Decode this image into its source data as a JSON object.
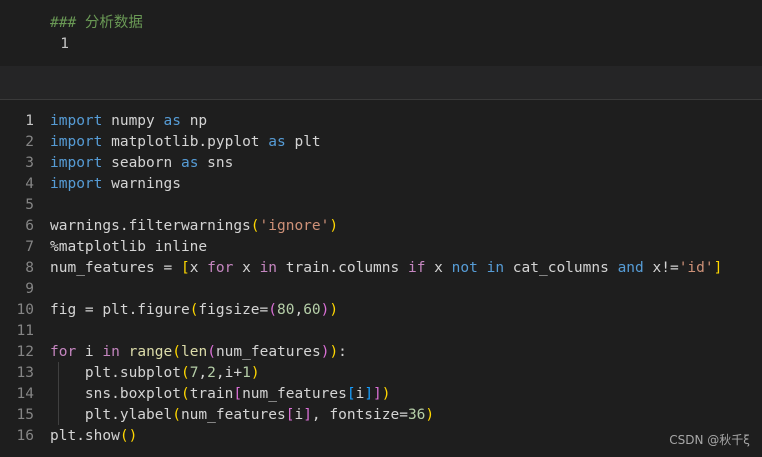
{
  "markdown_cell": {
    "line_number": "1",
    "text": "### 分析数据"
  },
  "code_cell": {
    "lines": [
      {
        "n": "1",
        "tokens": [
          {
            "t": "import",
            "c": "t-kw"
          },
          {
            "t": " numpy ",
            "c": "t-id"
          },
          {
            "t": "as",
            "c": "t-kw"
          },
          {
            "t": " np",
            "c": "t-id"
          }
        ]
      },
      {
        "n": "2",
        "tokens": [
          {
            "t": "import",
            "c": "t-kw"
          },
          {
            "t": " matplotlib.pyplot ",
            "c": "t-id"
          },
          {
            "t": "as",
            "c": "t-kw"
          },
          {
            "t": " plt",
            "c": "t-id"
          }
        ]
      },
      {
        "n": "3",
        "tokens": [
          {
            "t": "import",
            "c": "t-kw"
          },
          {
            "t": " seaborn ",
            "c": "t-id"
          },
          {
            "t": "as",
            "c": "t-kw"
          },
          {
            "t": " sns",
            "c": "t-id"
          }
        ]
      },
      {
        "n": "4",
        "tokens": [
          {
            "t": "import",
            "c": "t-kw"
          },
          {
            "t": " warnings",
            "c": "t-id"
          }
        ]
      },
      {
        "n": "5",
        "tokens": []
      },
      {
        "n": "6",
        "tokens": [
          {
            "t": "warnings.filterwarnings",
            "c": "t-id"
          },
          {
            "t": "(",
            "c": "p1"
          },
          {
            "t": "'ignore'",
            "c": "t-str"
          },
          {
            "t": ")",
            "c": "p1"
          }
        ]
      },
      {
        "n": "7",
        "tokens": [
          {
            "t": "%matplotlib inline",
            "c": "t-id"
          }
        ]
      },
      {
        "n": "8",
        "tokens": [
          {
            "t": "num_features = ",
            "c": "t-id"
          },
          {
            "t": "[",
            "c": "p1"
          },
          {
            "t": "x ",
            "c": "t-id"
          },
          {
            "t": "for",
            "c": "t-ctl"
          },
          {
            "t": " x ",
            "c": "t-id"
          },
          {
            "t": "in",
            "c": "t-ctl"
          },
          {
            "t": " train.columns ",
            "c": "t-id"
          },
          {
            "t": "if",
            "c": "t-ctl"
          },
          {
            "t": " x ",
            "c": "t-id"
          },
          {
            "t": "not",
            "c": "t-kw"
          },
          {
            "t": " ",
            "c": "t-id"
          },
          {
            "t": "in",
            "c": "t-kw"
          },
          {
            "t": " cat_columns ",
            "c": "t-id"
          },
          {
            "t": "and",
            "c": "t-kw"
          },
          {
            "t": " x!=",
            "c": "t-id"
          },
          {
            "t": "'id'",
            "c": "t-str"
          },
          {
            "t": "]",
            "c": "p1"
          }
        ]
      },
      {
        "n": "9",
        "tokens": []
      },
      {
        "n": "10",
        "tokens": [
          {
            "t": "fig = plt.figure",
            "c": "t-id"
          },
          {
            "t": "(",
            "c": "p1"
          },
          {
            "t": "figsize=",
            "c": "t-id"
          },
          {
            "t": "(",
            "c": "p2"
          },
          {
            "t": "80",
            "c": "t-num"
          },
          {
            "t": ",",
            "c": "t-id"
          },
          {
            "t": "60",
            "c": "t-num"
          },
          {
            "t": ")",
            "c": "p2"
          },
          {
            "t": ")",
            "c": "p1"
          }
        ]
      },
      {
        "n": "11",
        "tokens": []
      },
      {
        "n": "12",
        "tokens": [
          {
            "t": "for",
            "c": "t-ctl"
          },
          {
            "t": " i ",
            "c": "t-id"
          },
          {
            "t": "in",
            "c": "t-ctl"
          },
          {
            "t": " ",
            "c": "t-id"
          },
          {
            "t": "range",
            "c": "t-fn"
          },
          {
            "t": "(",
            "c": "p1"
          },
          {
            "t": "len",
            "c": "t-fn"
          },
          {
            "t": "(",
            "c": "p2"
          },
          {
            "t": "num_features",
            "c": "t-id"
          },
          {
            "t": ")",
            "c": "p2"
          },
          {
            "t": ")",
            "c": "p1"
          },
          {
            "t": ":",
            "c": "t-id"
          }
        ]
      },
      {
        "n": "13",
        "tokens": [
          {
            "t": "    plt.subplot",
            "c": "t-id"
          },
          {
            "t": "(",
            "c": "p1"
          },
          {
            "t": "7",
            "c": "t-num"
          },
          {
            "t": ",",
            "c": "t-id"
          },
          {
            "t": "2",
            "c": "t-num"
          },
          {
            "t": ",i+",
            "c": "t-id"
          },
          {
            "t": "1",
            "c": "t-num"
          },
          {
            "t": ")",
            "c": "p1"
          }
        ]
      },
      {
        "n": "14",
        "tokens": [
          {
            "t": "    sns.boxplot",
            "c": "t-id"
          },
          {
            "t": "(",
            "c": "p1"
          },
          {
            "t": "train",
            "c": "t-id"
          },
          {
            "t": "[",
            "c": "p2"
          },
          {
            "t": "num_features",
            "c": "t-id"
          },
          {
            "t": "[",
            "c": "p3"
          },
          {
            "t": "i",
            "c": "t-id"
          },
          {
            "t": "]",
            "c": "p3"
          },
          {
            "t": "]",
            "c": "p2"
          },
          {
            "t": ")",
            "c": "p1"
          }
        ]
      },
      {
        "n": "15",
        "tokens": [
          {
            "t": "    plt.ylabel",
            "c": "t-id"
          },
          {
            "t": "(",
            "c": "p1"
          },
          {
            "t": "num_features",
            "c": "t-id"
          },
          {
            "t": "[",
            "c": "p2"
          },
          {
            "t": "i",
            "c": "t-id"
          },
          {
            "t": "]",
            "c": "p2"
          },
          {
            "t": ", fontsize=",
            "c": "t-id"
          },
          {
            "t": "36",
            "c": "t-num"
          },
          {
            "t": ")",
            "c": "p1"
          }
        ]
      },
      {
        "n": "16",
        "tokens": [
          {
            "t": "plt.show",
            "c": "t-id"
          },
          {
            "t": "(",
            "c": "p1"
          },
          {
            "t": ")",
            "c": "p1"
          }
        ]
      }
    ]
  },
  "watermark": "CSDN @秋千ξ"
}
